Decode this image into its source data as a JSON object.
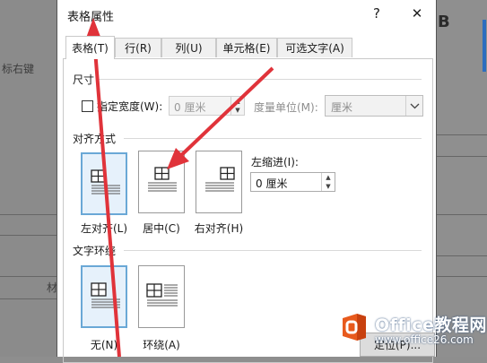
{
  "background": {
    "left_text_1": "标右键",
    "left_text_2": "材",
    "right_text": "B"
  },
  "dialog": {
    "title": "表格属性",
    "help_label": "?",
    "close_label": "✕"
  },
  "tabs": [
    {
      "label": "表格(T)",
      "active": true
    },
    {
      "label": "行(R)",
      "active": false
    },
    {
      "label": "列(U)",
      "active": false
    },
    {
      "label": "单元格(E)",
      "active": false
    },
    {
      "label": "可选文字(A)",
      "active": false
    }
  ],
  "size": {
    "section_label": "尺寸",
    "preferred_width_label": "指定宽度(W):",
    "preferred_width_checked": false,
    "width_value": "0 厘米",
    "measure_in_label": "度量单位(M):",
    "measure_in_value": "厘米"
  },
  "alignment": {
    "section_label": "对齐方式",
    "options": [
      {
        "label": "左对齐(L)",
        "selected": true
      },
      {
        "label": "居中(C)",
        "selected": false
      },
      {
        "label": "右对齐(H)",
        "selected": false
      }
    ],
    "indent_label": "左缩进(I):",
    "indent_value": "0 厘米"
  },
  "text_wrapping": {
    "section_label": "文字环绕",
    "options": [
      {
        "label": "无(N)",
        "selected": true
      },
      {
        "label": "环绕(A)",
        "selected": false
      }
    ]
  },
  "footer": {
    "positioning_label": "定位(P)..."
  },
  "watermark": {
    "brand": "Office教程网",
    "url": "www.office26.com"
  },
  "colors": {
    "annotation_arrow": "#e0333a",
    "selected_border": "#6aa8d6",
    "selected_fill": "#e6f1fb",
    "watermark_orange": "#e85a1d"
  }
}
